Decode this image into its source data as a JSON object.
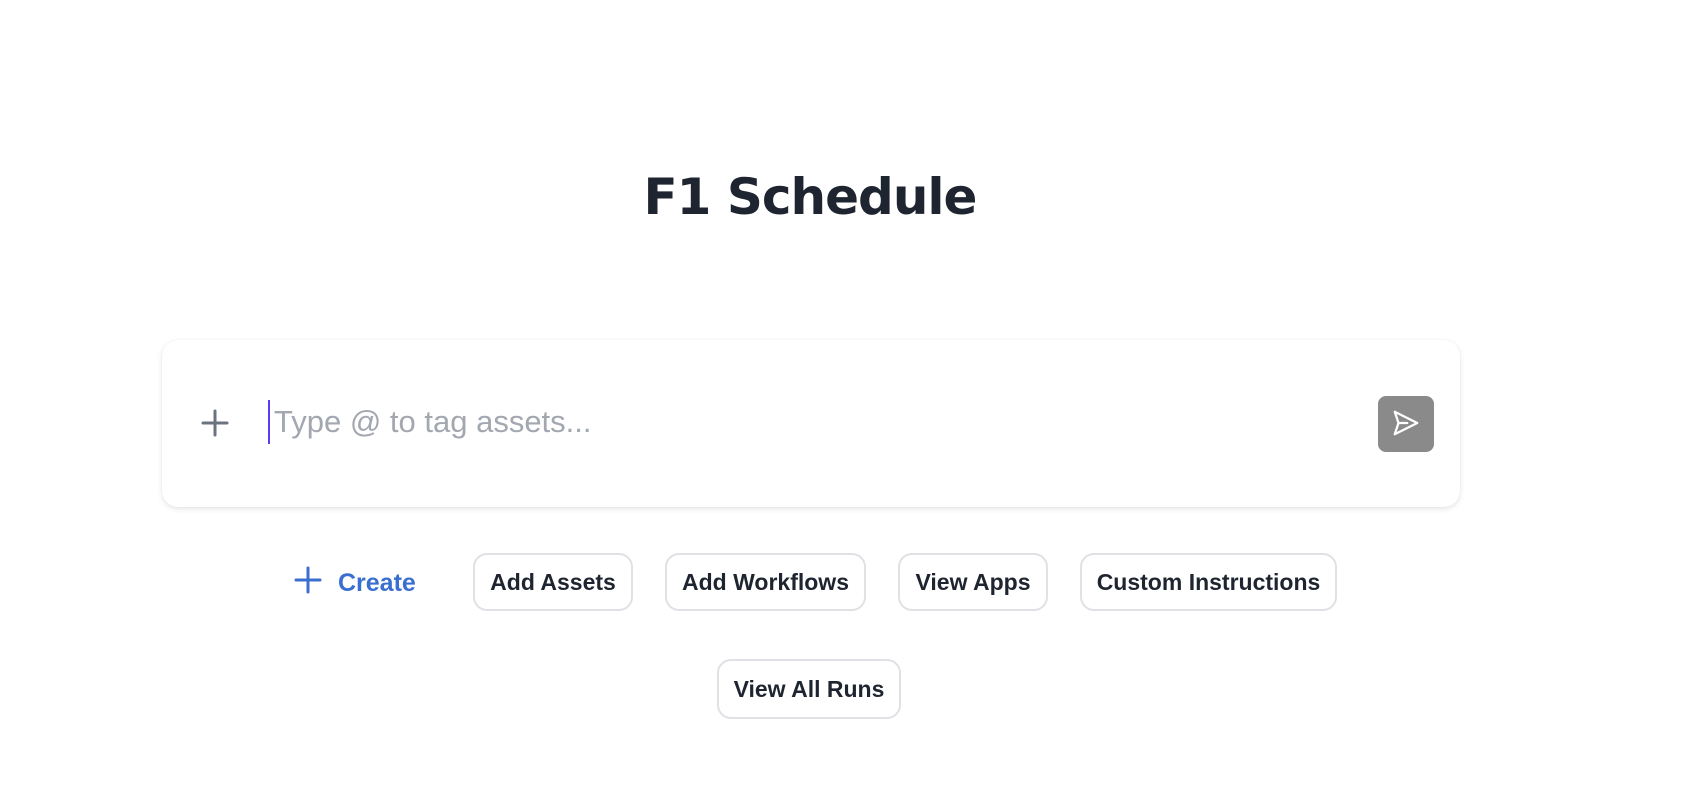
{
  "page": {
    "title": "F1 Schedule"
  },
  "composer": {
    "placeholder": "Type @ to tag assets...",
    "value": "",
    "add_icon": "plus-icon",
    "send_icon": "send-icon"
  },
  "actions": {
    "create_label": "Create",
    "add_assets_label": "Add Assets",
    "add_workflows_label": "Add Workflows",
    "view_apps_label": "View Apps",
    "custom_instructions_label": "Custom Instructions",
    "view_all_runs_label": "View All Runs"
  },
  "colors": {
    "title": "#1f2530",
    "accent_blue": "#3a6fd0",
    "send_button_bg": "#8a8a8a",
    "placeholder": "#a2a7b0",
    "cursor": "#5b3df5",
    "pill_border": "#dfe1e5"
  }
}
